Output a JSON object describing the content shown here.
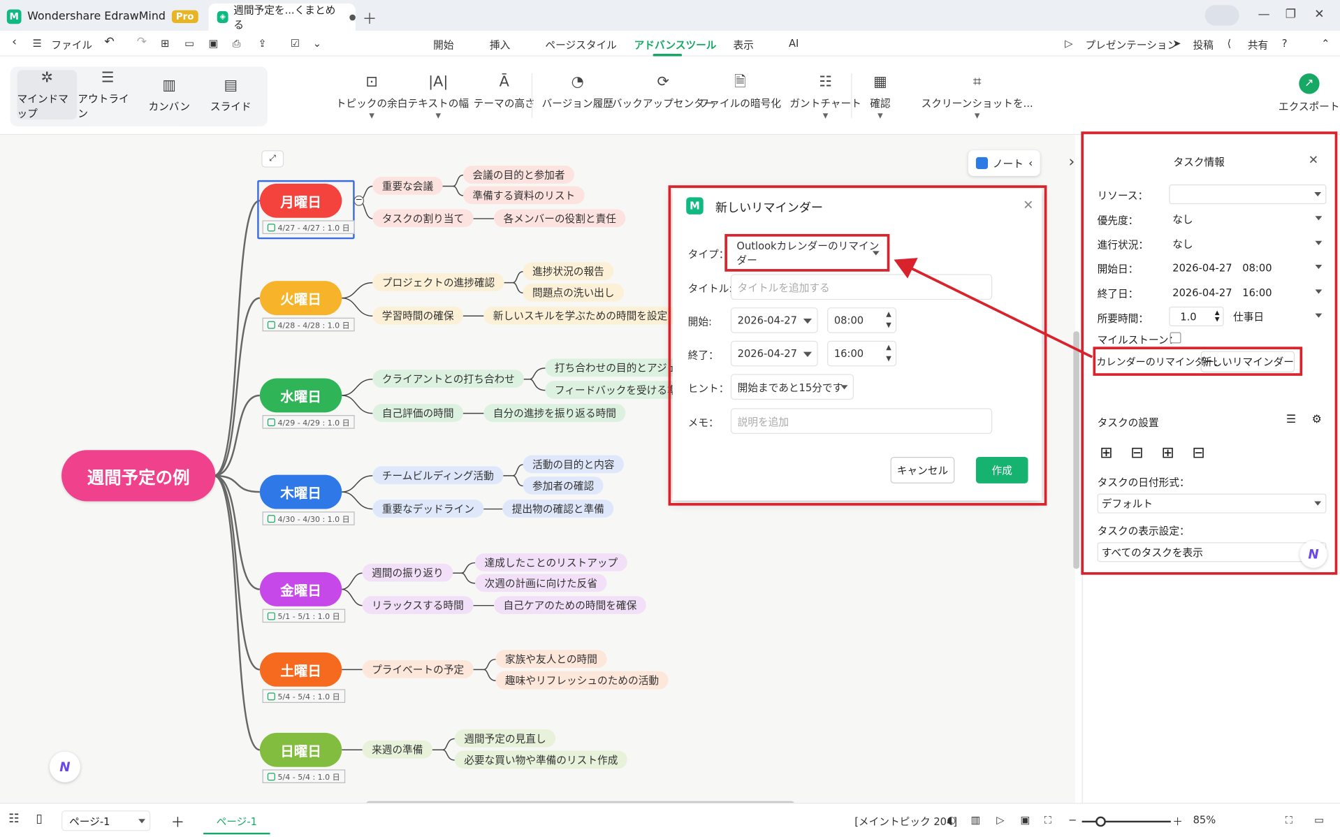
{
  "app": {
    "name": "Wondershare EdrawMind",
    "pro": "Pro",
    "doc_tab": "週間予定を...くまとめる"
  },
  "menu": {
    "file": "ファイル",
    "tabs": [
      "開始",
      "挿入",
      "ページスタイル",
      "アドバンスツール",
      "表示",
      "AI"
    ],
    "active_tab": "アドバンスツール",
    "present": "プレゼンテーション",
    "post": "投稿",
    "share": "共有"
  },
  "views": [
    "マインドマップ",
    "アウトライン",
    "カンバン",
    "スライド"
  ],
  "tools": [
    "トピックの余白",
    "テキストの幅",
    "テーマの高さ",
    "バージョン履歴",
    "バックアップセンター",
    "ファイルの暗号化",
    "ガントチャート",
    "確認",
    "スクリーンショットを...",
    "エクスポート"
  ],
  "mindmap": {
    "root": "週間予定の例",
    "days": [
      {
        "label": "月曜日",
        "color": "#f4433c",
        "date": "4/27 - 4/27 : 1.0 日",
        "b1": "重要な会議",
        "c1": [
          "会議の目的と参加者",
          "準備する資料のリスト"
        ],
        "b2": "タスクの割り当て",
        "c2": "各メンバーの役割と責任",
        "pill": "#fde3df"
      },
      {
        "label": "火曜日",
        "color": "#f7b42b",
        "date": "4/28 - 4/28 : 1.0 日",
        "b1": "プロジェクトの進捗確認",
        "c1": [
          "進捗状況の報告",
          "問題点の洗い出し"
        ],
        "b2": "学習時間の確保",
        "c2": "新しいスキルを学ぶための時間を設定",
        "pill": "#fcf0d6"
      },
      {
        "label": "水曜日",
        "color": "#2fb457",
        "date": "4/29 - 4/29 : 1.0 日",
        "b1": "クライアントとの打ち合わせ",
        "c1": [
          "打ち合わせの目的とアジェ",
          "フィードバックを受ける準"
        ],
        "b2": "自己評価の時間",
        "c2": "自分の進捗を振り返る時間",
        "pill": "#dcf1e0"
      },
      {
        "label": "木曜日",
        "color": "#2f78e8",
        "date": "4/30 - 4/30 : 1.0 日",
        "b1": "チームビルディング活動",
        "c1": [
          "活動の目的と内容",
          "参加者の確認"
        ],
        "b2": "重要なデッドライン",
        "c2": "提出物の確認と準備",
        "pill": "#dfe8fb"
      },
      {
        "label": "金曜日",
        "color": "#c648e8",
        "date": "5/1 - 5/1 : 1.0 日",
        "b1": "週間の振り返り",
        "c1": [
          "達成したことのリストアップ",
          "次週の計画に向けた反省"
        ],
        "b2": "リラックスする時間",
        "c2": "自己ケアのための時間を確保",
        "pill": "#f2e0f8"
      },
      {
        "label": "土曜日",
        "color": "#f66a1f",
        "date": "5/4 - 5/4 : 1.0 日",
        "b1": "プライベートの予定",
        "c1": [
          "家族や友人との時間",
          "趣味やリフレッシュのための活動"
        ],
        "pill": "#fde6da"
      },
      {
        "label": "日曜日",
        "color": "#82bd3f",
        "date": "5/4 - 5/4 : 1.0 日",
        "b1": "来週の準備",
        "c1": [
          "週間予定の見直し",
          "必要な買い物や準備のリスト作成"
        ],
        "pill": "#e8f2da"
      }
    ]
  },
  "note_label": "ノート",
  "dialog": {
    "title": "新しいリマインダー",
    "type_label": "タイプ：",
    "type_value": "Outlookカレンダーのリマインダー",
    "title_label": "タイトル:",
    "title_ph": "タイトルを追加する",
    "start_label": "開始:",
    "start_date": "2026-04-27",
    "start_time": "08:00",
    "end_label": "終了：",
    "end_date": "2026-04-27",
    "end_time": "16:00",
    "hint_label": "ヒント：",
    "hint_value": "開始まであと15分です",
    "memo_label": "メモ：",
    "memo_ph": "説明を追加",
    "cancel": "キャンセル",
    "create": "作成"
  },
  "panel": {
    "title": "タスク情報",
    "resource": "リソース：",
    "priority": "優先度：",
    "priority_v": "なし",
    "progress": "進行状況：",
    "progress_v": "なし",
    "start": "開始日：",
    "start_d": "2026-04-27",
    "start_t": "08:00",
    "end": "終了日：",
    "end_d": "2026-04-27",
    "end_t": "16:00",
    "duration": "所要時間：",
    "duration_v": "1.0",
    "duration_unit": "仕事日",
    "milestone": "マイルストーン：",
    "cal_label": "カレンダーのリマインダー:",
    "cal_btn": "新しいリマインダー",
    "settings": "タスクの設置",
    "date_fmt": "タスクの日付形式：",
    "date_fmt_v": "デフォルト",
    "display": "タスクの表示設定：",
    "display_v": "すべてのタスクを表示"
  },
  "status": {
    "page_select": "ページ-1",
    "page_tab": "ページ-1",
    "main_topic": "[メイントピック 204]",
    "zoom": "85%"
  }
}
